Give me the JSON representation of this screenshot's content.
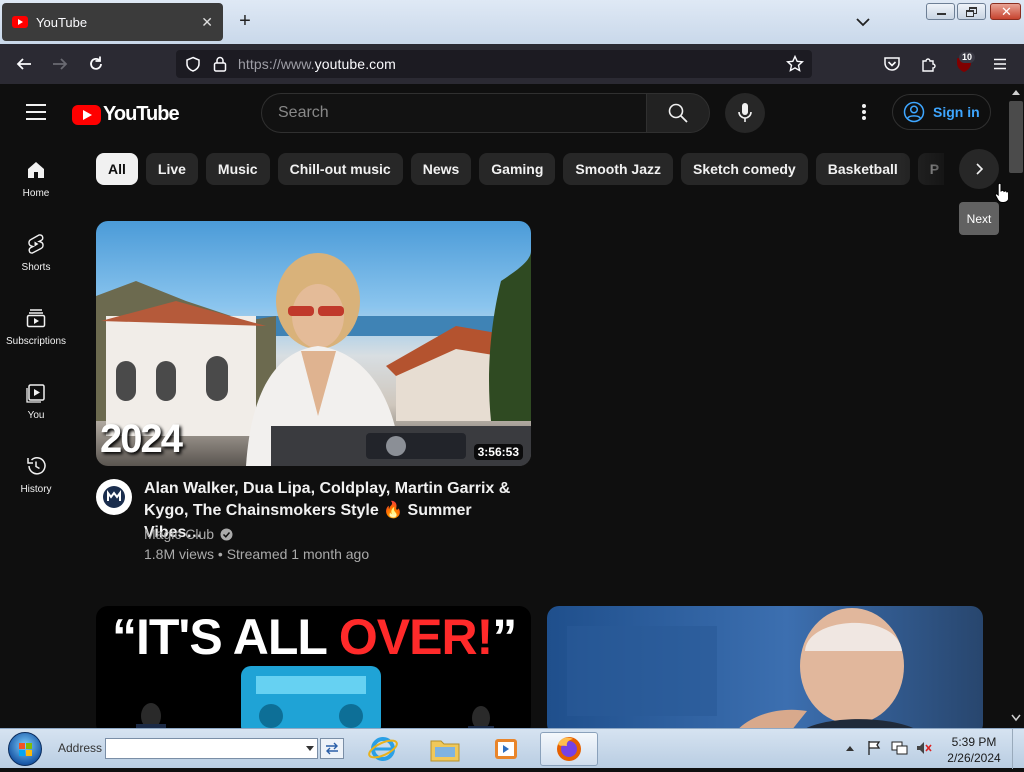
{
  "browser": {
    "tab_title": "YouTube",
    "url_prefix": "https://www.",
    "url_domain": "youtube.com",
    "extension_badge": "10"
  },
  "youtube": {
    "logo_text": "YouTube",
    "search_placeholder": "Search",
    "sign_in": "Sign in",
    "guide": [
      {
        "label": "Home",
        "icon": "home-icon"
      },
      {
        "label": "Shorts",
        "icon": "shorts-icon"
      },
      {
        "label": "Subscriptions",
        "icon": "subscriptions-icon"
      },
      {
        "label": "You",
        "icon": "you-icon"
      },
      {
        "label": "History",
        "icon": "history-icon"
      }
    ],
    "chips": [
      "All",
      "Live",
      "Music",
      "Chill-out music",
      "News",
      "Gaming",
      "Smooth Jazz",
      "Sketch comedy",
      "Basketball",
      "P"
    ],
    "tooltip": "Next",
    "video1": {
      "duration": "3:56:53",
      "overlay": "2024",
      "title": "Alan Walker, Dua Lipa, Coldplay, Martin Garrix & Kygo, The Chainsmokers Style 🔥 Summer Vibes…",
      "channel": "Magic Club",
      "meta": "1.8M views • Streamed 1 month ago"
    },
    "video2": {
      "overlay_white": "“IT'S ALL ",
      "overlay_red": "OVER!",
      "overlay_end": "”"
    }
  },
  "taskbar": {
    "address_label": "Address",
    "time": "5:39 PM",
    "date": "2/26/2024"
  },
  "colors": {
    "yt_bg": "#0f0f0f",
    "yt_red": "#ff0000",
    "link_blue": "#3ea6ff",
    "firefox_toolbar": "#2b2a33"
  }
}
